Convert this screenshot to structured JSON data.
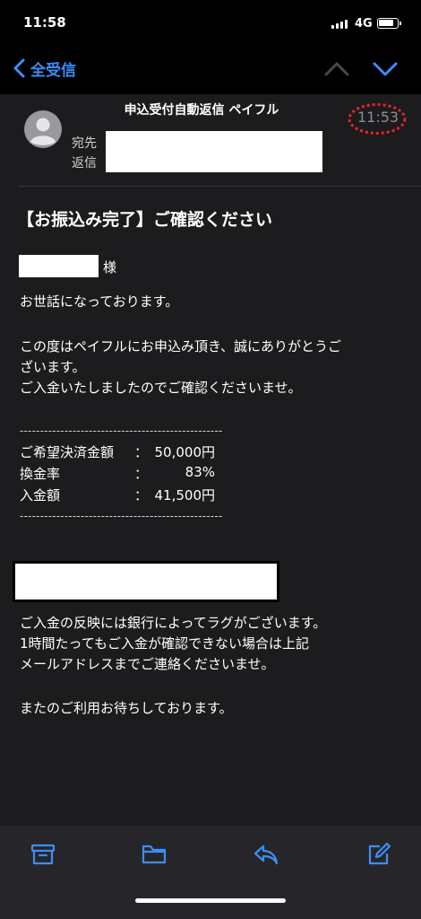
{
  "status": {
    "time": "11:58",
    "network": "4G"
  },
  "nav": {
    "back_label": "全受信"
  },
  "header": {
    "sender": "申込受付自動返信 ペイフル",
    "time": "11:53",
    "to_label": "宛先",
    "reply_label": "返信"
  },
  "message": {
    "subject": "【お振込み完了】ご確認ください",
    "honorific": "様",
    "greeting": "お世話になっております。",
    "thanks_line1": "この度はペイフルにお申込み頂き、誠にありがとうご",
    "thanks_line2": "ざいます。",
    "confirm": "ご入金いたしましたのでご確認くださいませ。",
    "divider": "--------------------------------------------------",
    "rows": [
      {
        "label": "ご希望決済金額",
        "colon": "：",
        "value": "50,000円"
      },
      {
        "label": "換金率",
        "colon": "：",
        "value": "83%"
      },
      {
        "label": "入金額",
        "colon": "：",
        "value": "41,500円"
      }
    ],
    "note_line1": "ご入金の反映には銀行によってラグがございます。",
    "note_line2": "1時間たってもご入金が確認できない場合は上記",
    "note_line3": "メールアドレスまでご連絡くださいませ。",
    "closing": "またのご利用お待ちしております。"
  },
  "toolbar": {
    "icons": [
      "archive-icon",
      "folder-icon",
      "reply-icon",
      "compose-icon"
    ]
  },
  "colors": {
    "accent": "#3d8ef7",
    "background": "#1c1c1e",
    "annotation": "#e0262a"
  }
}
